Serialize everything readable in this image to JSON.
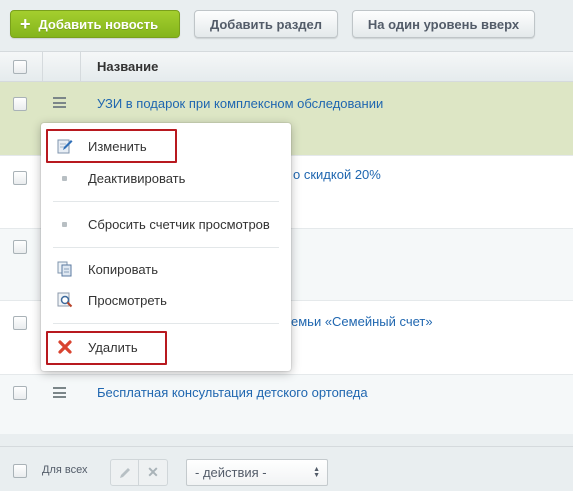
{
  "toolbar": {
    "add_news": "Добавить новость",
    "add_section": "Добавить раздел",
    "level_up": "На один уровень вверх"
  },
  "grid": {
    "column_title": "Название",
    "rows": [
      {
        "title": "УЗИ в подарок при комплексном обследовании",
        "highlighted": true
      },
      {
        "title": "о скидкой 20%",
        "highlighted": false
      },
      {
        "title": "",
        "highlighted": false
      },
      {
        "title": "емьи «Семейный счет»",
        "highlighted": false
      },
      {
        "title": "Бесплатная консультация детского ортопеда",
        "highlighted": false
      }
    ]
  },
  "context_menu": {
    "edit": "Изменить",
    "deactivate": "Деактивировать",
    "reset_counter": "Сбросить счетчик просмотров",
    "copy": "Копировать",
    "view": "Просмотреть",
    "delete": "Удалить"
  },
  "footer": {
    "for_all": "Для всех",
    "actions_select": "- действия -"
  },
  "colors": {
    "accent_green": "#8bbf22",
    "highlight_row": "#dde6c5",
    "link_blue": "#2067b0",
    "annotation_red": "#b8191f"
  }
}
